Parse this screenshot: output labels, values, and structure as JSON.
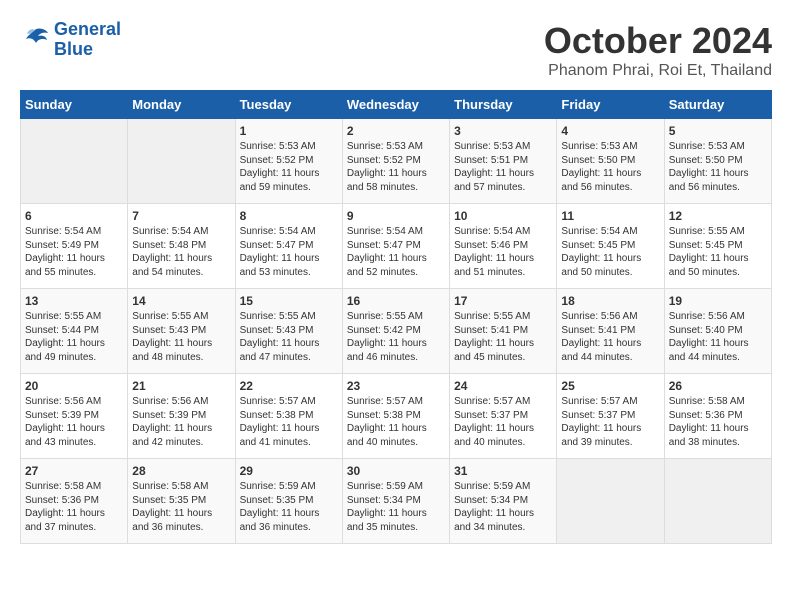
{
  "logo": {
    "line1": "General",
    "line2": "Blue"
  },
  "title": "October 2024",
  "subtitle": "Phanom Phrai, Roi Et, Thailand",
  "weekdays": [
    "Sunday",
    "Monday",
    "Tuesday",
    "Wednesday",
    "Thursday",
    "Friday",
    "Saturday"
  ],
  "weeks": [
    [
      {
        "day": "",
        "info": ""
      },
      {
        "day": "",
        "info": ""
      },
      {
        "day": "1",
        "info": "Sunrise: 5:53 AM\nSunset: 5:52 PM\nDaylight: 11 hours and 59 minutes."
      },
      {
        "day": "2",
        "info": "Sunrise: 5:53 AM\nSunset: 5:52 PM\nDaylight: 11 hours and 58 minutes."
      },
      {
        "day": "3",
        "info": "Sunrise: 5:53 AM\nSunset: 5:51 PM\nDaylight: 11 hours and 57 minutes."
      },
      {
        "day": "4",
        "info": "Sunrise: 5:53 AM\nSunset: 5:50 PM\nDaylight: 11 hours and 56 minutes."
      },
      {
        "day": "5",
        "info": "Sunrise: 5:53 AM\nSunset: 5:50 PM\nDaylight: 11 hours and 56 minutes."
      }
    ],
    [
      {
        "day": "6",
        "info": "Sunrise: 5:54 AM\nSunset: 5:49 PM\nDaylight: 11 hours and 55 minutes."
      },
      {
        "day": "7",
        "info": "Sunrise: 5:54 AM\nSunset: 5:48 PM\nDaylight: 11 hours and 54 minutes."
      },
      {
        "day": "8",
        "info": "Sunrise: 5:54 AM\nSunset: 5:47 PM\nDaylight: 11 hours and 53 minutes."
      },
      {
        "day": "9",
        "info": "Sunrise: 5:54 AM\nSunset: 5:47 PM\nDaylight: 11 hours and 52 minutes."
      },
      {
        "day": "10",
        "info": "Sunrise: 5:54 AM\nSunset: 5:46 PM\nDaylight: 11 hours and 51 minutes."
      },
      {
        "day": "11",
        "info": "Sunrise: 5:54 AM\nSunset: 5:45 PM\nDaylight: 11 hours and 50 minutes."
      },
      {
        "day": "12",
        "info": "Sunrise: 5:55 AM\nSunset: 5:45 PM\nDaylight: 11 hours and 50 minutes."
      }
    ],
    [
      {
        "day": "13",
        "info": "Sunrise: 5:55 AM\nSunset: 5:44 PM\nDaylight: 11 hours and 49 minutes."
      },
      {
        "day": "14",
        "info": "Sunrise: 5:55 AM\nSunset: 5:43 PM\nDaylight: 11 hours and 48 minutes."
      },
      {
        "day": "15",
        "info": "Sunrise: 5:55 AM\nSunset: 5:43 PM\nDaylight: 11 hours and 47 minutes."
      },
      {
        "day": "16",
        "info": "Sunrise: 5:55 AM\nSunset: 5:42 PM\nDaylight: 11 hours and 46 minutes."
      },
      {
        "day": "17",
        "info": "Sunrise: 5:55 AM\nSunset: 5:41 PM\nDaylight: 11 hours and 45 minutes."
      },
      {
        "day": "18",
        "info": "Sunrise: 5:56 AM\nSunset: 5:41 PM\nDaylight: 11 hours and 44 minutes."
      },
      {
        "day": "19",
        "info": "Sunrise: 5:56 AM\nSunset: 5:40 PM\nDaylight: 11 hours and 44 minutes."
      }
    ],
    [
      {
        "day": "20",
        "info": "Sunrise: 5:56 AM\nSunset: 5:39 PM\nDaylight: 11 hours and 43 minutes."
      },
      {
        "day": "21",
        "info": "Sunrise: 5:56 AM\nSunset: 5:39 PM\nDaylight: 11 hours and 42 minutes."
      },
      {
        "day": "22",
        "info": "Sunrise: 5:57 AM\nSunset: 5:38 PM\nDaylight: 11 hours and 41 minutes."
      },
      {
        "day": "23",
        "info": "Sunrise: 5:57 AM\nSunset: 5:38 PM\nDaylight: 11 hours and 40 minutes."
      },
      {
        "day": "24",
        "info": "Sunrise: 5:57 AM\nSunset: 5:37 PM\nDaylight: 11 hours and 40 minutes."
      },
      {
        "day": "25",
        "info": "Sunrise: 5:57 AM\nSunset: 5:37 PM\nDaylight: 11 hours and 39 minutes."
      },
      {
        "day": "26",
        "info": "Sunrise: 5:58 AM\nSunset: 5:36 PM\nDaylight: 11 hours and 38 minutes."
      }
    ],
    [
      {
        "day": "27",
        "info": "Sunrise: 5:58 AM\nSunset: 5:36 PM\nDaylight: 11 hours and 37 minutes."
      },
      {
        "day": "28",
        "info": "Sunrise: 5:58 AM\nSunset: 5:35 PM\nDaylight: 11 hours and 36 minutes."
      },
      {
        "day": "29",
        "info": "Sunrise: 5:59 AM\nSunset: 5:35 PM\nDaylight: 11 hours and 36 minutes."
      },
      {
        "day": "30",
        "info": "Sunrise: 5:59 AM\nSunset: 5:34 PM\nDaylight: 11 hours and 35 minutes."
      },
      {
        "day": "31",
        "info": "Sunrise: 5:59 AM\nSunset: 5:34 PM\nDaylight: 11 hours and 34 minutes."
      },
      {
        "day": "",
        "info": ""
      },
      {
        "day": "",
        "info": ""
      }
    ]
  ]
}
